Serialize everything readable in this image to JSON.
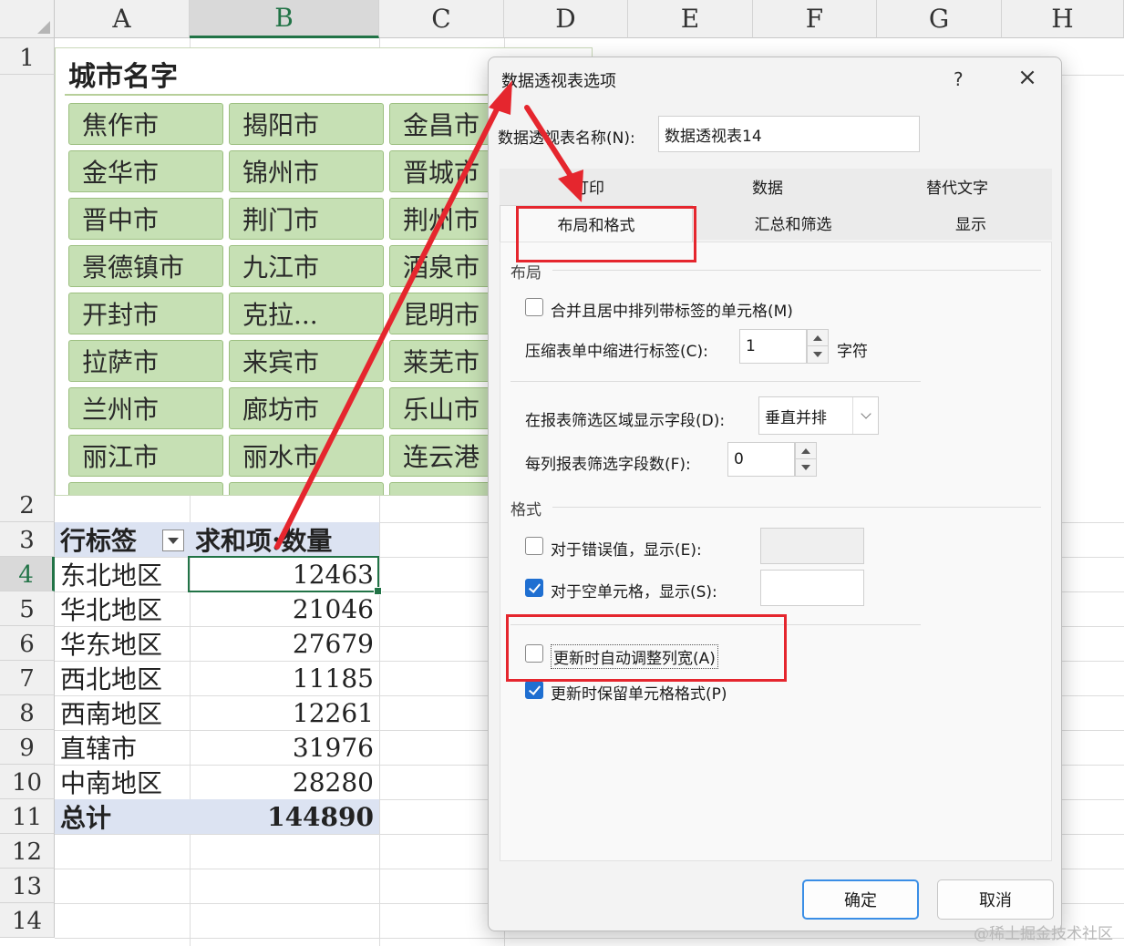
{
  "sheet": {
    "columns": [
      "A",
      "B",
      "C",
      "D",
      "E",
      "F",
      "G",
      "H"
    ],
    "rows": [
      "1",
      "2",
      "3",
      "4",
      "5",
      "6",
      "7",
      "8",
      "9",
      "10",
      "11",
      "12",
      "13",
      "14"
    ],
    "selected_column": "B",
    "selected_row": "4"
  },
  "slicer": {
    "title": "城市名字",
    "items": [
      [
        "焦作市",
        "揭阳市",
        "金昌市"
      ],
      [
        "金华市",
        "锦州市",
        "晋城市"
      ],
      [
        "晋中市",
        "荆门市",
        "荆州市"
      ],
      [
        "景德镇市",
        "九江市",
        "酒泉市"
      ],
      [
        "开封市",
        "克拉...",
        "昆明市"
      ],
      [
        "拉萨市",
        "来宾市",
        "莱芜市"
      ],
      [
        "兰州市",
        "廊坊市",
        "乐山市"
      ],
      [
        "丽江市",
        "丽水市",
        "连云港"
      ]
    ]
  },
  "pivot": {
    "row_label_header": "行标签",
    "value_header": "求和项:数量",
    "rows": [
      {
        "label": "东北地区",
        "value": "12463"
      },
      {
        "label": "华北地区",
        "value": "21046"
      },
      {
        "label": "华东地区",
        "value": "27679"
      },
      {
        "label": "西北地区",
        "value": "11185"
      },
      {
        "label": "西南地区",
        "value": "12261"
      },
      {
        "label": "直辖市",
        "value": "31976"
      },
      {
        "label": "中南地区",
        "value": "28280"
      }
    ],
    "total_label": "总计",
    "total_value": "144890"
  },
  "dialog": {
    "title": "数据透视表选项",
    "help": "?",
    "close": "×",
    "name_label": "数据透视表名称(N):",
    "name_value": "数据透视表14",
    "tabs_row1": [
      "打印",
      "数据",
      "替代文字"
    ],
    "tabs_row2": [
      "布局和格式",
      "汇总和筛选",
      "显示"
    ],
    "active_tab": "布局和格式",
    "layout_section": "布局",
    "merge_label": "合并且居中排列带标签的单元格(M)",
    "merge_checked": false,
    "indent_label": "压缩表单中缩进行标签(C):",
    "indent_value": "1",
    "indent_unit": "字符",
    "filter_area_label": "在报表筛选区域显示字段(D):",
    "filter_area_value": "垂直并排",
    "filter_count_label": "每列报表筛选字段数(F):",
    "filter_count_value": "0",
    "format_section": "格式",
    "error_label": "对于错误值，显示(E):",
    "error_checked": false,
    "error_value": "",
    "empty_label": "对于空单元格，显示(S):",
    "empty_checked": true,
    "empty_value": "",
    "autofit_label": "更新时自动调整列宽(A)",
    "autofit_checked": false,
    "preserve_label": "更新时保留单元格格式(P)",
    "preserve_checked": true,
    "ok_label": "确定",
    "cancel_label": "取消"
  },
  "watermark": "@稀土掘金技术社区",
  "colors": {
    "accent": "#217346",
    "slicer_button": "#c6e0b4",
    "pivot_band": "#dce3f2",
    "annotation_red": "#e5262e",
    "checkbox_blue": "#1f6fd1"
  }
}
